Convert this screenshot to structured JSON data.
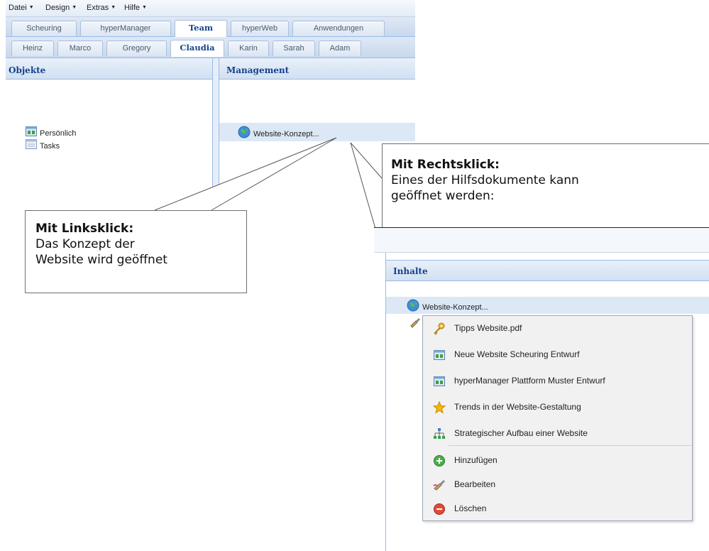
{
  "menubar": {
    "items": [
      {
        "label": "Datei"
      },
      {
        "label": "Design"
      },
      {
        "label": "Extras"
      },
      {
        "label": "Hilfe"
      }
    ]
  },
  "main_tabs": [
    {
      "label": "Scheuring"
    },
    {
      "label": "hyperManager"
    },
    {
      "label": "Team"
    },
    {
      "label": "hyperWeb"
    },
    {
      "label": "Anwendungen"
    }
  ],
  "person_tabs": [
    {
      "label": "Heinz"
    },
    {
      "label": "Marco"
    },
    {
      "label": "Gregory"
    },
    {
      "label": "Claudia"
    },
    {
      "label": "Karin"
    },
    {
      "label": "Sarah"
    },
    {
      "label": "Adam"
    }
  ],
  "objekte_panel": {
    "title": "Objekte",
    "items": [
      {
        "label": "Persönlich",
        "icon": "folder-grid-icon"
      },
      {
        "label": "Tasks",
        "icon": "task-list-icon"
      }
    ]
  },
  "management_panel": {
    "title": "Management",
    "item": {
      "label": "Website-Konzept...",
      "icon": "globe-icon"
    }
  },
  "callout_left": {
    "title": "Mit Linksklick:",
    "line1": "Das Konzept der",
    "line2": "Website wird geöffnet"
  },
  "callout_right": {
    "title": "Mit Rechtsklick:",
    "line1": "Eines der Hilfsdokumente kann",
    "line2": "geöffnet werden:"
  },
  "inhalte_panel": {
    "title": "Inhalte",
    "item": {
      "label": "Website-Konzept...",
      "icon": "globe-icon"
    }
  },
  "context_menu": {
    "items": [
      {
        "label": "Tipps Website.pdf",
        "icon": "key-icon"
      },
      {
        "label": "Neue Website Scheuring Entwurf",
        "icon": "folder-grid-icon"
      },
      {
        "label": "hyperManager Plattform Muster Entwurf",
        "icon": "folder-grid-icon"
      },
      {
        "label": "Trends in der Website-Gestaltung",
        "icon": "star-icon"
      },
      {
        "label": "Strategischer Aufbau einer Website",
        "icon": "sitemap-icon"
      },
      {
        "label": "Hinzufügen",
        "icon": "add-icon"
      },
      {
        "label": "Bearbeiten",
        "icon": "edit-brush-icon"
      },
      {
        "label": "Löschen",
        "icon": "delete-icon"
      }
    ]
  },
  "colors": {
    "header_text": "#15428b",
    "border_blue": "#99bbe8",
    "selection_bg": "#dce8f6"
  }
}
